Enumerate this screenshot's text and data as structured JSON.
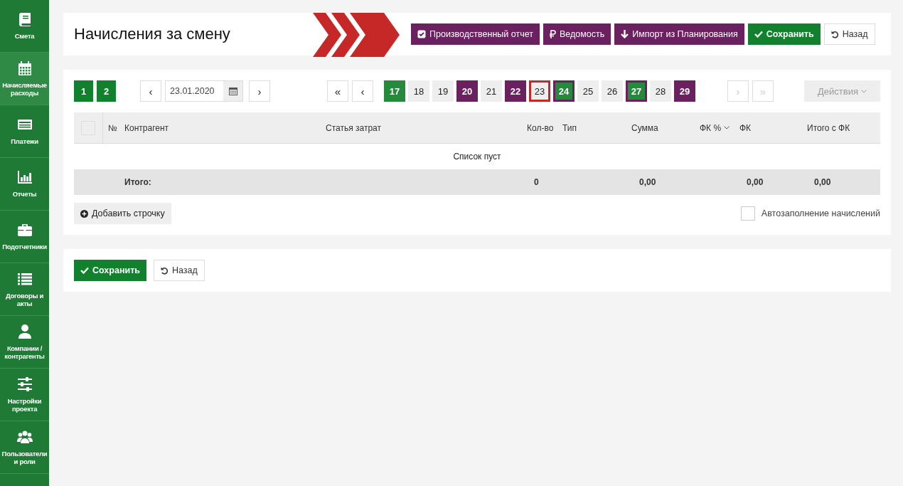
{
  "sidebar": {
    "items": [
      {
        "label": "Смета",
        "selected": false
      },
      {
        "label": "Начисляемые расходы",
        "selected": true
      },
      {
        "label": "Платежи",
        "selected": false
      },
      {
        "label": "Отчеты",
        "selected": false
      },
      {
        "label": "Подотчетники",
        "selected": false
      },
      {
        "label": "Договоры и акты",
        "selected": false
      },
      {
        "label": "Компании / контрагенты",
        "selected": false
      },
      {
        "label": "Настройки проекта",
        "selected": false
      },
      {
        "label": "Пользователи и роли",
        "selected": false
      }
    ]
  },
  "header": {
    "title": "Начисления за смену",
    "buttons": [
      {
        "label": "Производственный отчет",
        "kind": "purple"
      },
      {
        "label": "Ведомость",
        "kind": "purple"
      },
      {
        "label": "Импорт из Планирования",
        "kind": "purple"
      },
      {
        "label": "Сохранить",
        "kind": "green"
      },
      {
        "label": "Назад",
        "kind": "plain"
      }
    ]
  },
  "toolbar": {
    "pages": [
      {
        "label": "1"
      },
      {
        "label": "2"
      }
    ],
    "prev": "‹",
    "date": "23.01.2020",
    "next": "›",
    "first": "«",
    "day_prev": "‹",
    "days": [
      {
        "label": "17",
        "kind": "green",
        "selected": false
      },
      {
        "label": "18",
        "kind": "plain",
        "selected": false
      },
      {
        "label": "19",
        "kind": "plain",
        "selected": false
      },
      {
        "label": "20",
        "kind": "purple",
        "selected": false
      },
      {
        "label": "21",
        "kind": "plain",
        "selected": false
      },
      {
        "label": "22",
        "kind": "purple",
        "selected": false
      },
      {
        "label": "23",
        "kind": "plain",
        "selected": true
      },
      {
        "label": "24",
        "kind": "green-marked",
        "selected": false
      },
      {
        "label": "25",
        "kind": "plain",
        "selected": false
      },
      {
        "label": "26",
        "kind": "plain",
        "selected": false
      },
      {
        "label": "27",
        "kind": "green-marked",
        "selected": false
      },
      {
        "label": "28",
        "kind": "plain",
        "selected": false
      },
      {
        "label": "29",
        "kind": "purple",
        "selected": false
      }
    ],
    "day_next": "›",
    "last": "»",
    "actions": "Действия"
  },
  "table": {
    "select_all": {
      "checked": false
    },
    "columns": [
      "№",
      "Контрагент",
      "Статья затрат",
      "Кол-во",
      "Тип",
      "Сумма",
      "ФК %",
      "ФК",
      "Итого с ФК"
    ],
    "empty": "Список пуст",
    "total": {
      "label": "Итого:",
      "qty": "0",
      "sum": "0,00",
      "fk": "0,00",
      "total_fk": "0,00"
    }
  },
  "add_row": "Добавить строчку",
  "autofill": {
    "label": "Автозаполнение начислений",
    "checked": false
  },
  "footer": {
    "buttons": [
      {
        "label": "Сохранить",
        "kind": "green"
      },
      {
        "label": "Назад",
        "kind": "plain"
      }
    ]
  }
}
